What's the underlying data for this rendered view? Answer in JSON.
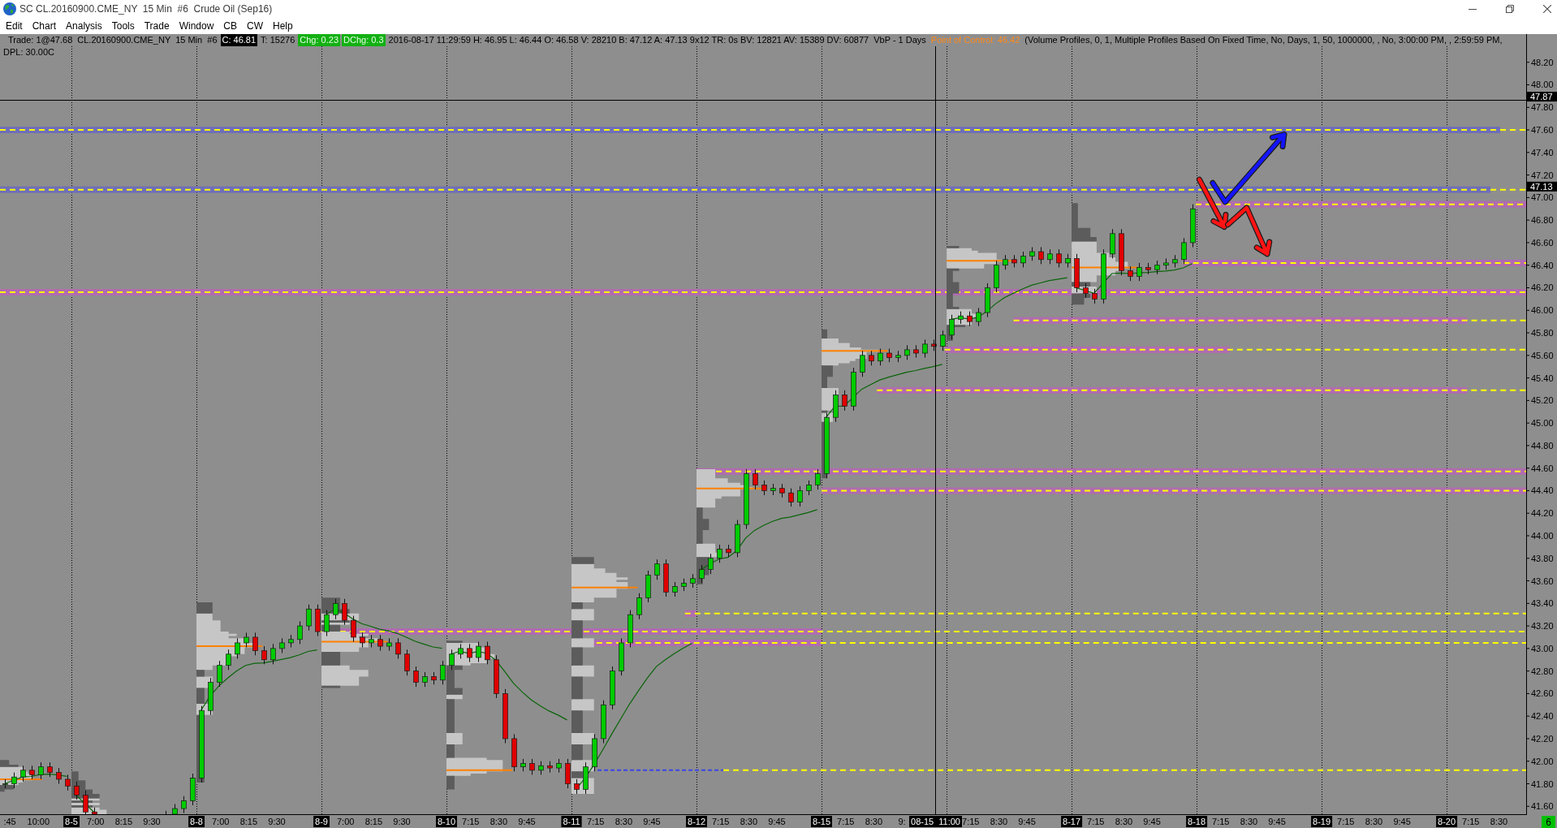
{
  "window": {
    "title": "SC CL.20160900.CME_NY  15 Min  #6  Crude Oil (Sep16)"
  },
  "menu": [
    "Edit",
    "Chart",
    "Analysis",
    "Tools",
    "Trade",
    "Window",
    "CB",
    "CW",
    "Help"
  ],
  "chart": {
    "header": {
      "line_1": [
        {
          "kind": "plain",
          "text": "Trade: 1@47.68"
        },
        {
          "kind": "plain",
          "text": "CL.20160900.CME_NY  15 Min  #6"
        },
        {
          "kind": "inverse",
          "text": "C: 46.81"
        },
        {
          "kind": "plain",
          "text": "T: 15276"
        },
        {
          "kind": "up",
          "text": "Chg: 0.23"
        },
        {
          "kind": "up",
          "text": "DChg: 0.3"
        },
        {
          "kind": "plain",
          "text": "2016-08-17 11:29:59 H: 46.95 L: 46.44 O: 46.58 V: 28210 B: 47.12 A: 47.13 9x12 TR: 0s BV: 12821 AV: 15389 DV: 60877  VbP - 1 Days"
        },
        {
          "kind": "study",
          "text": "Point of Control: 46.42"
        },
        {
          "kind": "plain",
          "text": "(Volume Profiles, 0, 1, Multiple Profiles Based On Fixed Time, No, Days, 1, 50, 1000000, , No, 3:00:00 PM, , 2:59:59 PM,"
        }
      ],
      "line_2": "DPL: 30.00C"
    },
    "price_axis": [
      "48.20",
      "48.00",
      "47.80",
      "47.60",
      "47.40",
      "47.20",
      "47.00",
      "46.80",
      "46.60",
      "46.40",
      "46.20",
      "46.00",
      "45.80",
      "45.60",
      "45.40",
      "45.20",
      "45.00",
      "44.80",
      "44.60",
      "44.40",
      "44.20",
      "44.00",
      "43.80",
      "43.60",
      "43.40",
      "43.20",
      "43.00",
      "42.80",
      "42.60",
      "42.40",
      "42.20",
      "42.00",
      "41.80",
      "41.60"
    ],
    "time_axis": [
      {
        "times": [
          ":45",
          "10:00"
        ]
      },
      {
        "date": "8-5",
        "times": [
          "7:00",
          "8:15",
          "9:30"
        ]
      },
      {
        "date": "8-8",
        "times": [
          "7:00",
          "8:15",
          "9:30"
        ]
      },
      {
        "date": "8-9",
        "times": [
          "7:00",
          "8:15",
          "9:30"
        ]
      },
      {
        "date": "8-10",
        "times": [
          "7:15",
          "8:30",
          "9:45"
        ]
      },
      {
        "date": "8-11",
        "times": [
          "7:15",
          "8:30",
          "9:45"
        ]
      },
      {
        "date": "8-12",
        "times": [
          "7:15",
          "8:30",
          "9:45"
        ]
      },
      {
        "date": "8-15",
        "times": [
          "7:15",
          "8:30",
          "9:"
        ]
      },
      {
        "times": [
          "7:15",
          "8:30",
          "9:45"
        ]
      },
      {
        "date": "8-17",
        "times": [
          "7:15",
          "8:30",
          "9:45"
        ]
      },
      {
        "date": "8-18",
        "times": [
          "7:15",
          "8:30",
          "9:45"
        ]
      },
      {
        "date": "8-19",
        "times": [
          "7:15",
          "8:30",
          "9:45"
        ]
      },
      {
        "date": "8-20",
        "times": [
          "7:15",
          "8:30"
        ]
      }
    ],
    "crosshair": {
      "price_label": "47.87",
      "time_label": "08-15  11:00"
    },
    "price_marker": "47.13",
    "badge": "6"
  }
}
